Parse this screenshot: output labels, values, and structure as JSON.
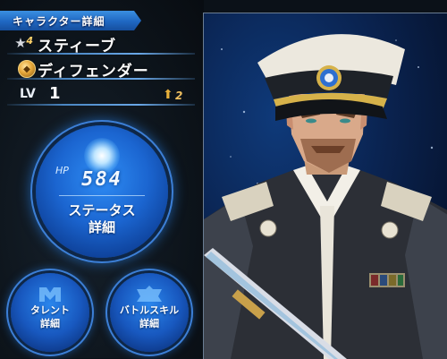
{
  "header": {
    "title": "キャラクター詳細"
  },
  "character": {
    "rank": "4",
    "name": "スティーブ",
    "class": "ディフェンダー",
    "level_label": "LV",
    "level": "1",
    "boost_count": "2",
    "hp_label": "HP",
    "hp": "584"
  },
  "buttons": {
    "status": "ステータス\n詳細",
    "talent": "タレント\n詳細",
    "battle_skill": "バトルスキル\n詳細"
  },
  "colors": {
    "accent_blue": "#1f67c2",
    "gold": "#e6a83a"
  },
  "icons": {
    "rank": "star-icon",
    "class": "shield-class-icon",
    "boost": "up-arrow-icon",
    "talent": "talent-emblem-icon",
    "skill": "skill-emblem-icon"
  }
}
